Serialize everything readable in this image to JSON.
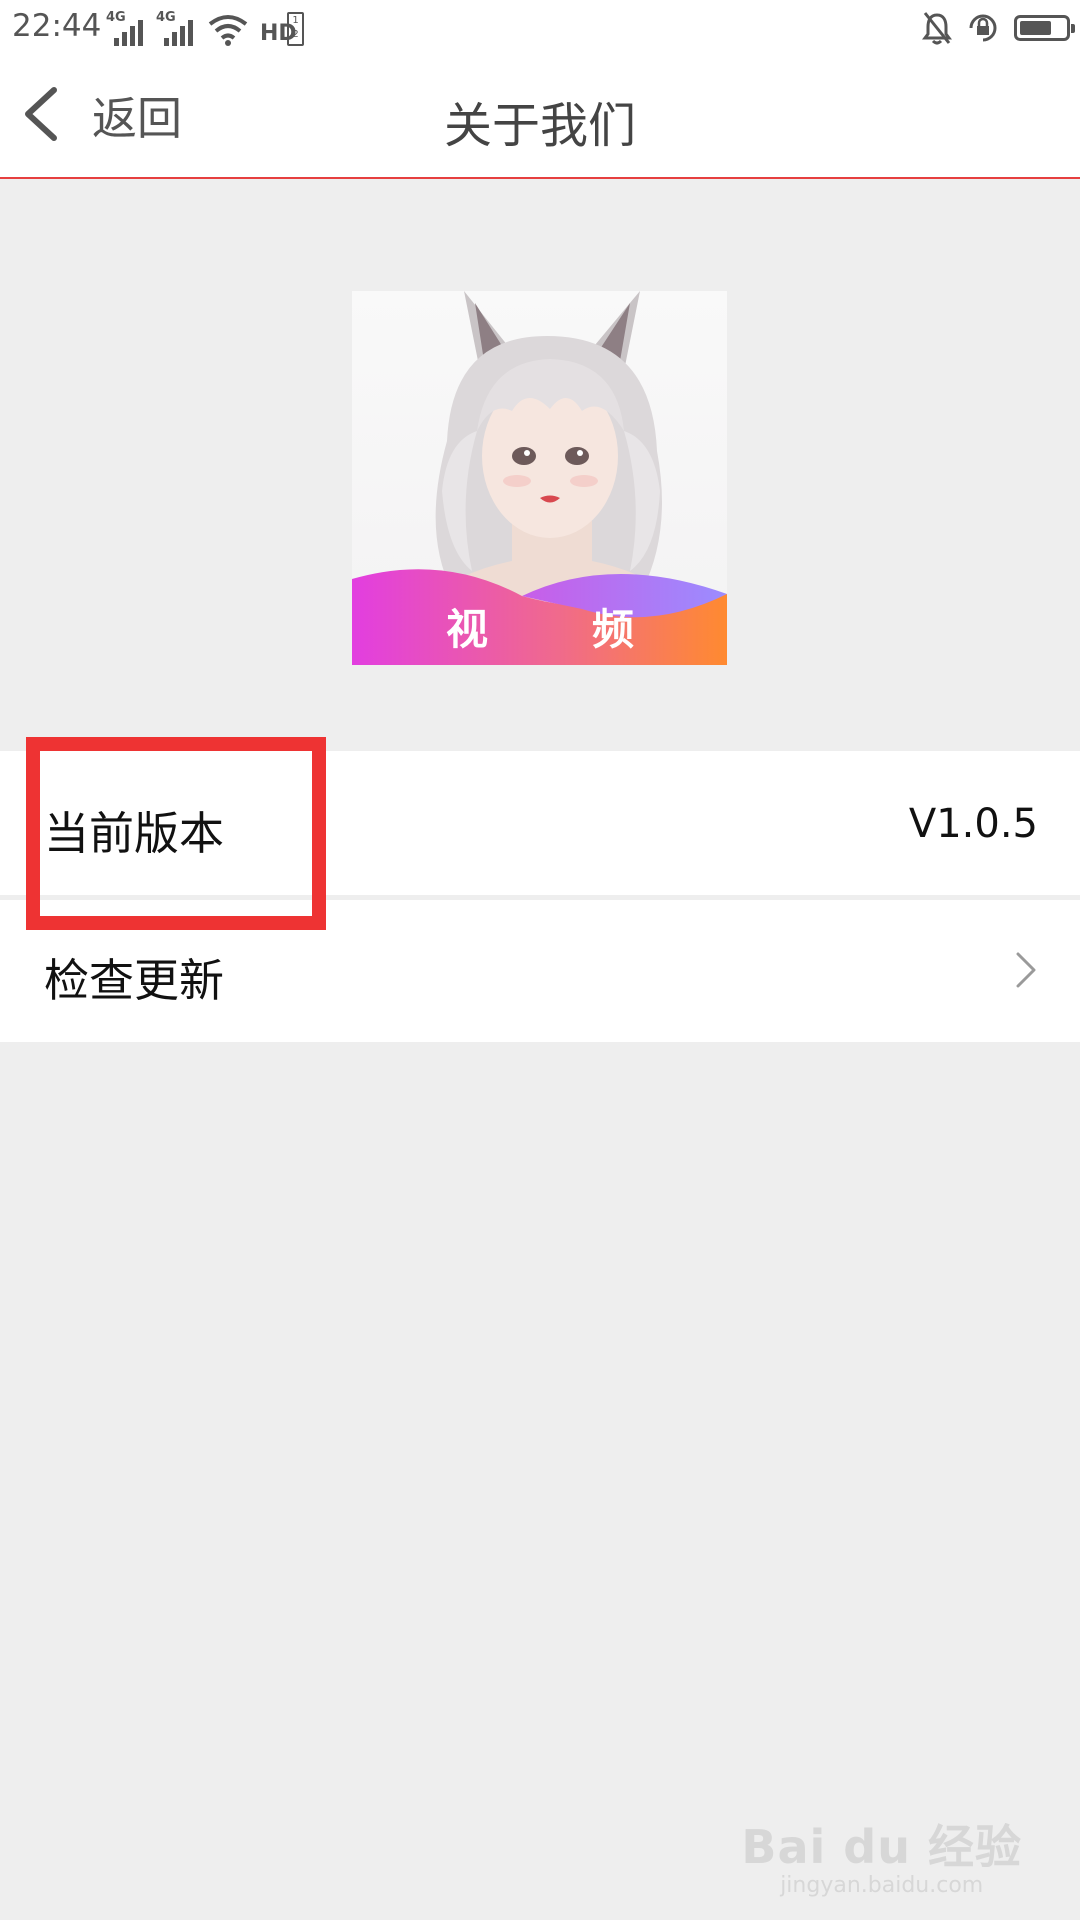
{
  "status_bar": {
    "time": "22:44",
    "network_1": "4G",
    "network_2": "4G",
    "hd": "HD",
    "hd_sim": "1 2",
    "battery_level": 0.7
  },
  "header": {
    "back_label": "返回",
    "title": "关于我们",
    "accent_color": "#e63f3f"
  },
  "logo": {
    "char_1": "视",
    "char_2": "频"
  },
  "list": {
    "version_label": "当前版本",
    "version_value": "V1.0.5",
    "update_label": "检查更新"
  },
  "annotation": {
    "highlight_color": "#ee3333"
  },
  "watermark": {
    "main": "Bai du 经验",
    "sub": "jingyan.baidu.com"
  }
}
